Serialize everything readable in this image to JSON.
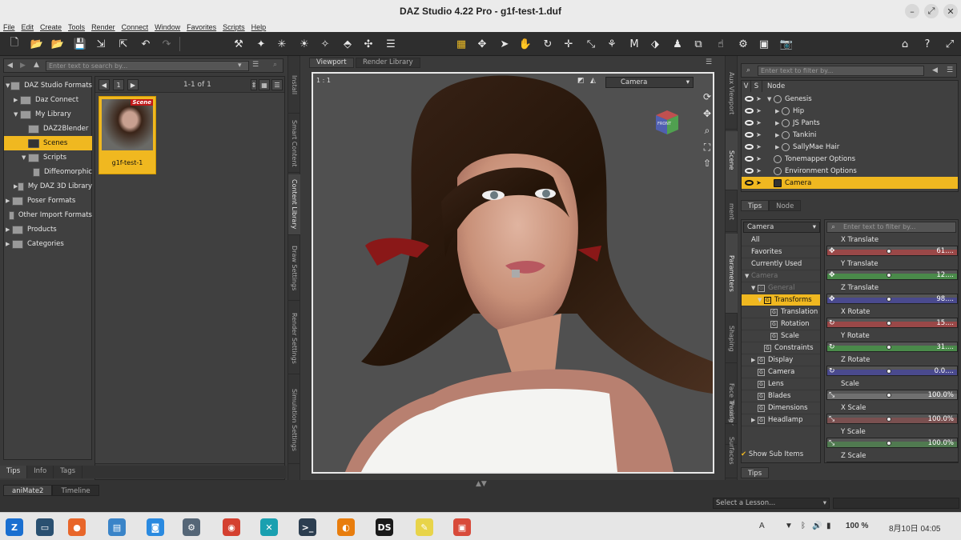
{
  "window": {
    "title": "DAZ Studio 4.22 Pro - g1f-test-1.duf",
    "min_label": "–",
    "restore_label": "⤢",
    "close_label": "✕"
  },
  "menu": [
    "File",
    "Edit",
    "Create",
    "Tools",
    "Render",
    "Connect",
    "Window",
    "Favorites",
    "Scripts",
    "Help"
  ],
  "content_library": {
    "search_placeholder": "Enter text to search by...",
    "page_number": "1",
    "page_info": "1-1 of 1",
    "tree": [
      {
        "label": "DAZ Studio Formats",
        "depth": 0,
        "arrow": "▼",
        "selected": false
      },
      {
        "label": "Daz Connect",
        "depth": 1,
        "arrow": "▶",
        "selected": false
      },
      {
        "label": "My Library",
        "depth": 1,
        "arrow": "▼",
        "selected": false
      },
      {
        "label": "DAZ2Blender",
        "depth": 2,
        "arrow": "",
        "selected": false
      },
      {
        "label": "Scenes",
        "depth": 2,
        "arrow": "",
        "selected": true
      },
      {
        "label": "Scripts",
        "depth": 2,
        "arrow": "▼",
        "selected": false
      },
      {
        "label": "Diffeomorphic",
        "depth": 3,
        "arrow": "",
        "selected": false
      },
      {
        "label": "My DAZ 3D Library",
        "depth": 1,
        "arrow": "▶",
        "selected": false
      },
      {
        "label": "Poser Formats",
        "depth": 0,
        "arrow": "▶",
        "selected": false
      },
      {
        "label": "Other Import Formats",
        "depth": 0,
        "arrow": "",
        "selected": false
      },
      {
        "label": "Products",
        "depth": 0,
        "arrow": "▶",
        "selected": false
      },
      {
        "label": "Categories",
        "depth": 0,
        "arrow": "▶",
        "selected": false
      }
    ],
    "item": {
      "name": "g1f-test-1",
      "badge": "Scene"
    },
    "bottom_tabs": [
      "Tips",
      "Info",
      "Tags"
    ]
  },
  "left_vtabs": [
    "Install",
    "Smart Content",
    "Content Library",
    "Draw Settings",
    "Render Settings",
    "Simulation Settings"
  ],
  "viewport": {
    "tabs": [
      "Viewport",
      "Render Library"
    ],
    "ratio": "1 : 1",
    "camera": "Camera",
    "cube_label": "FRONT"
  },
  "right_vtabs": [
    "Aux Viewport",
    "Scene",
    "ment",
    "Parameters",
    "Shaping",
    "Face Transfer",
    "Posing",
    "Surfaces"
  ],
  "scene": {
    "filter_placeholder": "Enter text to filter by...",
    "headers": [
      "V",
      "S",
      "Node"
    ],
    "nodes": [
      {
        "label": "Genesis",
        "depth": 0,
        "arrow": "▼",
        "selected": false
      },
      {
        "label": "Hip",
        "depth": 1,
        "arrow": "▶",
        "selected": false
      },
      {
        "label": "JS Pants",
        "depth": 1,
        "arrow": "▶",
        "selected": false
      },
      {
        "label": "Tankini",
        "depth": 1,
        "arrow": "▶",
        "selected": false
      },
      {
        "label": "SallyMae Hair",
        "depth": 1,
        "arrow": "▶",
        "selected": false
      },
      {
        "label": "Tonemapper Options",
        "depth": 0,
        "arrow": "",
        "selected": false
      },
      {
        "label": "Environment Options",
        "depth": 0,
        "arrow": "",
        "selected": false
      },
      {
        "label": "Camera",
        "depth": 0,
        "arrow": "",
        "selected": true
      }
    ],
    "tabs": [
      "Tips",
      "Node"
    ]
  },
  "parameters": {
    "node": "Camera",
    "filter_placeholder": "Enter text to filter by...",
    "groups": [
      {
        "label": "All",
        "depth": 0,
        "arrow": "",
        "style": "normal"
      },
      {
        "label": "Favorites",
        "depth": 0,
        "arrow": "",
        "style": "normal"
      },
      {
        "label": "Currently Used",
        "depth": 0,
        "arrow": "",
        "style": "normal"
      },
      {
        "label": "Camera",
        "depth": 0,
        "arrow": "▼",
        "style": "dim"
      },
      {
        "label": "General",
        "depth": 1,
        "arrow": "▼",
        "style": "dim"
      },
      {
        "label": "Transforms",
        "depth": 2,
        "arrow": "▼",
        "style": "sel"
      },
      {
        "label": "Translation",
        "depth": 3,
        "arrow": "",
        "style": "normal"
      },
      {
        "label": "Rotation",
        "depth": 3,
        "arrow": "",
        "style": "normal"
      },
      {
        "label": "Scale",
        "depth": 3,
        "arrow": "",
        "style": "normal"
      },
      {
        "label": "Constraints",
        "depth": 2,
        "arrow": "",
        "style": "normal"
      },
      {
        "label": "Display",
        "depth": 1,
        "arrow": "▶",
        "style": "normal"
      },
      {
        "label": "Camera",
        "depth": 1,
        "arrow": "",
        "style": "normal"
      },
      {
        "label": "Lens",
        "depth": 1,
        "arrow": "",
        "style": "normal"
      },
      {
        "label": "Blades",
        "depth": 1,
        "arrow": "",
        "style": "normal"
      },
      {
        "label": "Dimensions",
        "depth": 1,
        "arrow": "",
        "style": "normal"
      },
      {
        "label": "Headlamp",
        "depth": 1,
        "arrow": "▶",
        "style": "normal"
      }
    ],
    "sliders": [
      {
        "name": "X Translate",
        "value": "61....",
        "color": "#9a4848",
        "icon": "✥"
      },
      {
        "name": "Y Translate",
        "value": "12....",
        "color": "#4a8a4a",
        "icon": "✥"
      },
      {
        "name": "Z Translate",
        "value": "98....",
        "color": "#4a4a8e",
        "icon": "✥"
      },
      {
        "name": "X Rotate",
        "value": "15....",
        "color": "#9a4848",
        "icon": "↻"
      },
      {
        "name": "Y Rotate",
        "value": "31....",
        "color": "#4a8a4a",
        "icon": "↻"
      },
      {
        "name": "Z Rotate",
        "value": "0.0....",
        "color": "#4a4a8e",
        "icon": "↻"
      },
      {
        "name": "Scale",
        "value": "100.0%",
        "color": "#707070",
        "icon": "⤡"
      },
      {
        "name": "X Scale",
        "value": "100.0%",
        "color": "#7a5050",
        "icon": "⤡"
      },
      {
        "name": "Y Scale",
        "value": "100.0%",
        "color": "#507a50",
        "icon": "⤡"
      },
      {
        "name": "Z Scale",
        "value": "",
        "color": "#50507a",
        "icon": "⤡"
      }
    ],
    "show_sub_items": "Show Sub Items",
    "tips_tab": "Tips"
  },
  "bottom": {
    "tabs": [
      "aniMate2",
      "Timeline"
    ],
    "lesson_placeholder": "Select a Lesson..."
  },
  "taskbar": {
    "input_method": "A",
    "battery": "100 %",
    "clock": "8月10日  04:05",
    "apps": [
      {
        "name": "zorin-icon",
        "color": "#1a6fd0",
        "glyph": "Z"
      },
      {
        "name": "desktop-icon",
        "color": "#2a5070",
        "glyph": "▭"
      },
      {
        "name": "firefox-icon",
        "color": "#e8662a",
        "glyph": "●"
      },
      {
        "name": "files-icon",
        "color": "#3a84c8",
        "glyph": "▤"
      },
      {
        "name": "store-icon",
        "color": "#2a8ae0",
        "glyph": "◙"
      },
      {
        "name": "settings-icon",
        "color": "#556677",
        "glyph": "⚙"
      },
      {
        "name": "chrome-icon",
        "color": "#d44030",
        "glyph": "◉"
      },
      {
        "name": "sync-icon",
        "color": "#1aa0b0",
        "glyph": "✕"
      },
      {
        "name": "terminal-icon",
        "color": "#2c3e50",
        "glyph": ">_"
      },
      {
        "name": "blender-icon",
        "color": "#e87d0d",
        "glyph": "◐"
      },
      {
        "name": "daz-icon",
        "color": "#1a1a1a",
        "glyph": "DS"
      },
      {
        "name": "notes-icon",
        "color": "#e8d44a",
        "glyph": "✎"
      },
      {
        "name": "screenshot-icon",
        "color": "#d84a3a",
        "glyph": "▣"
      }
    ]
  }
}
